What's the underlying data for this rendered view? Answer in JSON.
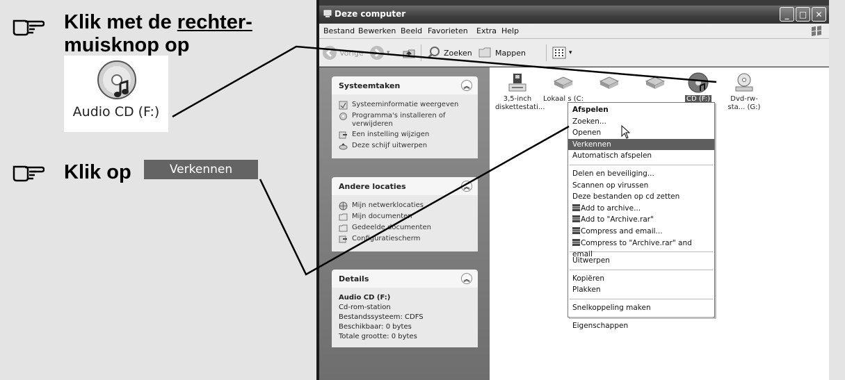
{
  "instructions": {
    "step1_prefix": "Klik met de ",
    "step1_underlined": "rechter-",
    "step1_line2": "muisknop op",
    "cd_label": "Audio CD (F:)",
    "step2_prefix": "Klik op",
    "step2_button": "Verkennen"
  },
  "window": {
    "title": "Deze computer",
    "controls": [
      "_",
      "□",
      "✕"
    ]
  },
  "menubar": [
    "Bestand",
    "Bewerken",
    "Beeld",
    "Favorieten",
    "Extra",
    "Help"
  ],
  "toolbar": {
    "back": "Vorige",
    "search": "Zoeken",
    "folders": "Mappen"
  },
  "taskpane": {
    "system": {
      "title": "Systeemtaken",
      "links": [
        "Systeeminformatie weergeven",
        "Programma's installeren of verwijderen",
        "Een instelling wijzigen",
        "Deze schijf uitwerpen"
      ]
    },
    "other": {
      "title": "Andere locaties",
      "links": [
        "Mijn netwerklocaties",
        "Mijn documenten",
        "Gedeelde documenten",
        "Configuratiescherm"
      ]
    },
    "details": {
      "title": "Details",
      "name": "Audio CD (F:)",
      "type": "Cd-rom-station",
      "fs": "Bestandssysteem: CDFS",
      "free": "Beschikbaar: 0 bytes",
      "total": "Totale grootte: 0 bytes"
    }
  },
  "drives": [
    {
      "label": "3,5-inch diskettestati...",
      "icon": "floppy-icon"
    },
    {
      "label": "Lokaal s (C:",
      "icon": "hard-disk-icon"
    },
    {
      "label": "",
      "icon": "hard-disk-icon"
    },
    {
      "label": "",
      "icon": "hard-disk-icon"
    },
    {
      "label": "CD (F:)",
      "icon": "audio-cd-icon"
    },
    {
      "label": "Dvd-rw-sta... (G:)",
      "icon": "dvd-drive-icon"
    }
  ],
  "context_menu": {
    "items": [
      "Afspelen",
      "Zoeken...",
      "Openen",
      "Verkennen",
      "Automatisch afspelen",
      "Delen en beveiliging...",
      "Scannen op virussen",
      "Deze bestanden op cd zetten",
      "Add to archive...",
      "Add to \"Archive.rar\"",
      "Compress and email...",
      "Compress to \"Archive.rar\" and email",
      "Uitwerpen",
      "Kopiëren",
      "Plakken",
      "Snelkoppeling maken",
      "Eigenschappen"
    ]
  }
}
